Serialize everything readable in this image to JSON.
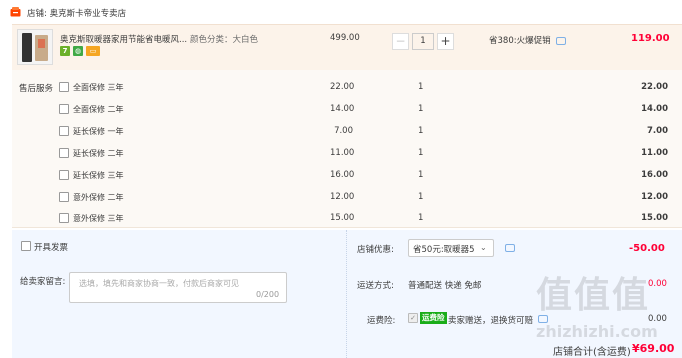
{
  "store": {
    "label": "店铺: 奥克斯卡帝业专卖店",
    "icon": "store-icon"
  },
  "product": {
    "title": "奥克斯取暖器家用节能省电暖风...",
    "attr": "颜色分类：大白色",
    "unit_price": "499.00",
    "quantity": "1",
    "promo": "省380:火爆促销",
    "total": "119.00",
    "badges": [
      "seven-day-return-icon",
      "authentic-guarantee-icon",
      "credit-card-icon"
    ],
    "badge_colors": [
      "#6bb02a",
      "#40a946",
      "#f5a623"
    ]
  },
  "services": {
    "label": "售后服务",
    "items": [
      {
        "name": "全面保修 三年",
        "price": "22.00",
        "qty": "1",
        "total": "22.00"
      },
      {
        "name": "全面保修 二年",
        "price": "14.00",
        "qty": "1",
        "total": "14.00"
      },
      {
        "name": "延长保修 一年",
        "price": "7.00",
        "qty": "1",
        "total": "7.00"
      },
      {
        "name": "延长保修 二年",
        "price": "11.00",
        "qty": "1",
        "total": "11.00"
      },
      {
        "name": "延长保修 三年",
        "price": "16.00",
        "qty": "1",
        "total": "16.00"
      },
      {
        "name": "意外保修 二年",
        "price": "12.00",
        "qty": "1",
        "total": "12.00"
      },
      {
        "name": "意外保修 三年",
        "price": "15.00",
        "qty": "1",
        "total": "15.00"
      }
    ]
  },
  "invoice": {
    "label": "开具发票"
  },
  "message": {
    "label": "给卖家留言:",
    "placeholder": "选填，填先和商家协商一致，付款后商家可见",
    "count": "0/200"
  },
  "discount": {
    "label": "店铺优惠:",
    "value": "省50元:取暖器5",
    "amount": "-50.00"
  },
  "shipping": {
    "label": "运送方式:",
    "value": "普通配送 快递 免邮",
    "amount": "0.00"
  },
  "insurance": {
    "label": "运费险:",
    "badge": "运费险",
    "text": "卖家赠送，退换货可赔",
    "amount": "0.00"
  },
  "totals": {
    "label": "店铺合计(含运费)",
    "amount": "¥69.00"
  },
  "watermark": {
    "text": "值值值",
    "url": "zhizhizhi.com"
  },
  "colors": {
    "accent_red": "#ff0036",
    "product_bg": "#fcf3ea",
    "service_bg": "#fcf9f5",
    "bottom_bg": "#f2f7ff"
  }
}
